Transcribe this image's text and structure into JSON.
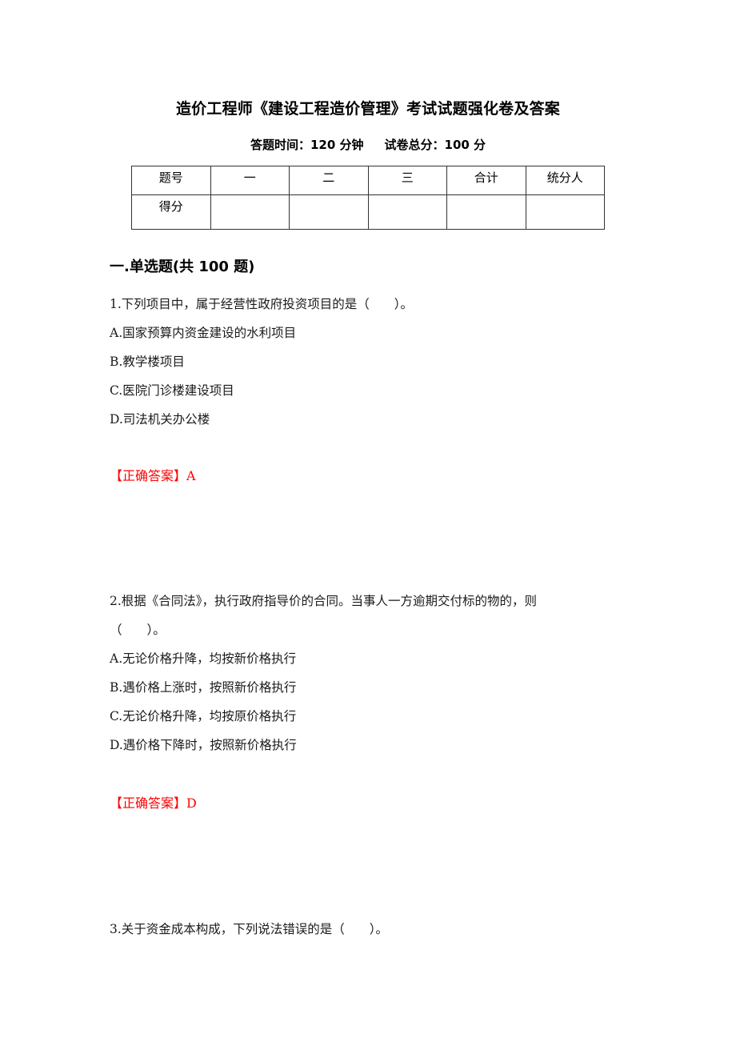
{
  "document": {
    "title": "造价工程师《建设工程造价管理》考试试题强化卷及答案",
    "meta": {
      "time_label": "答题时间：120 分钟",
      "score_label": "试卷总分：100 分"
    },
    "score_table": {
      "header": [
        "题号",
        "一",
        "二",
        "三",
        "合计",
        "统分人"
      ],
      "row_label": "得分",
      "row_values": [
        "",
        "",
        "",
        "",
        ""
      ]
    },
    "section": {
      "title": "一.单选题(共 100 题)"
    },
    "questions": [
      {
        "stem_lines": [
          "1.下列项目中，属于经营性政府投资项目的是（　　）。"
        ],
        "options": [
          "A.国家预算内资金建设的水利项目",
          "B.教学楼项目",
          "C.医院门诊楼建设项目",
          "D.司法机关办公楼"
        ],
        "answer": "【正确答案】A"
      },
      {
        "stem_lines": [
          "2.根据《合同法》，执行政府指导价的合同。当事人一方逾期交付标的物的，则",
          "（　　）。"
        ],
        "options": [
          "A.无论价格升降，均按新价格执行",
          "B.遇价格上涨时，按照新价格执行",
          "C.无论价格升降，均按原价格执行",
          "D.遇价格下降时，按照新价格执行"
        ],
        "answer": "【正确答案】D"
      },
      {
        "stem_lines": [
          "3.关于资金成本构成，下列说法错误的是（　　）。"
        ],
        "options": [],
        "answer": ""
      }
    ],
    "colors": {
      "text": "#000000",
      "answer": "#ff0000",
      "table_border": "#333333"
    }
  }
}
